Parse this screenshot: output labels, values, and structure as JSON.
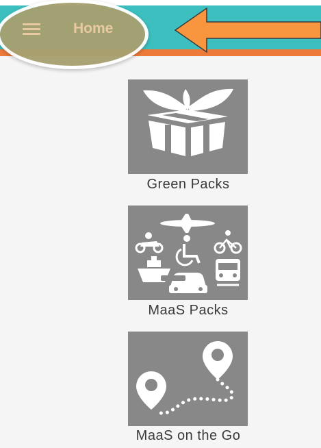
{
  "appbar": {
    "title": "Home",
    "menu_icon": "hamburger-menu-icon",
    "colors": {
      "primary": "#3dbfbf",
      "accent": "#ee7a3a",
      "title": "#e8c9a3"
    }
  },
  "annotation": {
    "arrow_icon": "left-arrow-icon",
    "color": "#f7963e"
  },
  "menu": {
    "items": [
      {
        "label": "Green Packs",
        "icon": "gift-box-icon"
      },
      {
        "label": "MaaS Packs",
        "icon": "transport-modes-icon"
      },
      {
        "label": "MaaS on the Go",
        "icon": "route-pins-icon"
      }
    ]
  }
}
